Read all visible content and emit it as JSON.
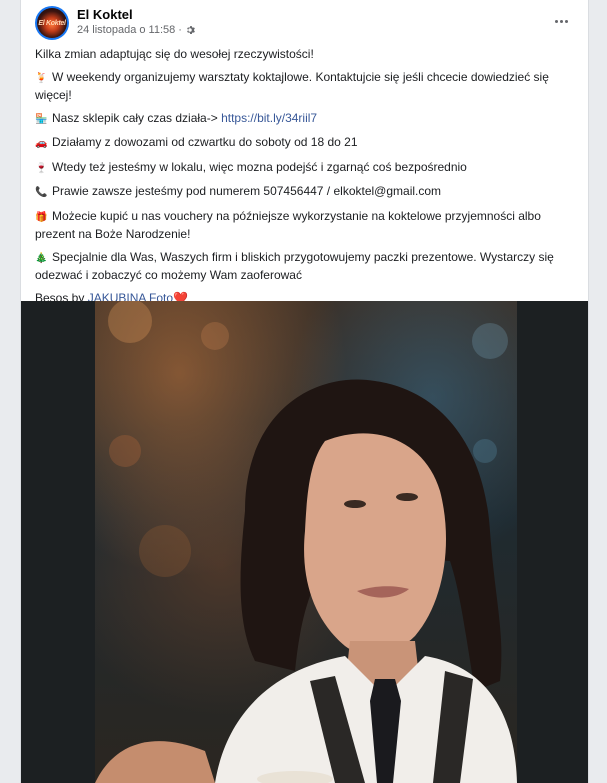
{
  "post": {
    "page_name": "El Koktel",
    "timestamp": "24 listopada o 11:58",
    "avatar_text": "El Koktel",
    "paragraphs": [
      {
        "emoji": "",
        "text": "Kilka zmian adaptując się do wesołej rzeczywistości!"
      },
      {
        "emoji": "🍹",
        "text": "W weekendy organizujemy warsztaty koktajlowe. Kontaktujcie się jeśli chcecie dowiedzieć się więcej!"
      },
      {
        "emoji": "🏪",
        "text": "Nasz sklepik cały czas działa-> ",
        "link": "https://bit.ly/34riil7"
      },
      {
        "emoji": "🚗",
        "text": "Działamy z dowozami od czwartku do soboty od 18 do 21"
      },
      {
        "emoji": "🍷",
        "text": "Wtedy też jesteśmy w lokalu, więc mozna podejść i zgarnąć coś bezpośrednio"
      },
      {
        "emoji": "📞",
        "text": "Prawie zawsze jesteśmy pod numerem 507456447 / elkoktel@gmail.com"
      },
      {
        "emoji": "🎁",
        "text": "Możecie kupić u nas vouchery na późniejsze wykorzystanie na koktelowe przyjemności albo prezent na Boże Narodzenie!"
      },
      {
        "emoji": "🎄",
        "text": "Specjalnie dla Was, Waszych firm i bliskich przygotowujemy paczki prezentowe. Wystarczy się odezwać i zobaczyć co możemy Wam zaoferować"
      }
    ],
    "credit_prefix": "Besos by ",
    "credit_link": "JAKUBINA Foto",
    "credit_suffix": "❤️"
  },
  "icons": {
    "privacy": "gear-icon",
    "more": "more-options-icon"
  },
  "colors": {
    "link": "#385898",
    "secondary_text": "#65676b",
    "avatar_ring": "#1877f2"
  }
}
